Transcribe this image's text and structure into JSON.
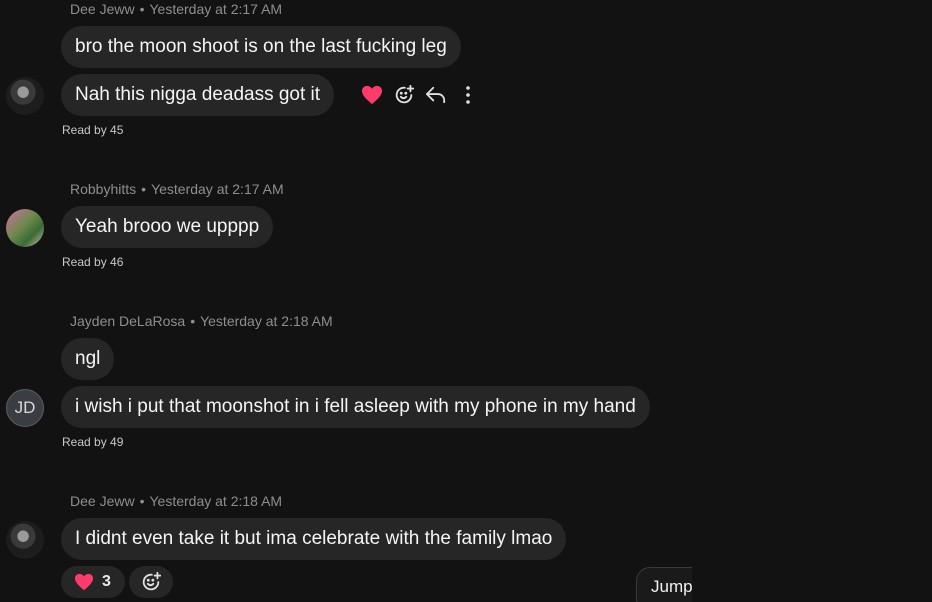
{
  "messages": [
    {
      "sender": "Dee Jeww",
      "time": "Yesterday at 2:17 AM",
      "bubbles": [
        "bro the moon shoot is on the last fucking leg",
        "Nah this nigga deadass got it"
      ],
      "read": "Read by 45"
    },
    {
      "sender": "Robbyhitts",
      "time": "Yesterday at 2:17 AM",
      "bubbles": [
        "Yeah brooo we upppp"
      ],
      "read": "Read by 46"
    },
    {
      "sender": "Jayden DeLaRosa",
      "time": "Yesterday at 2:18 AM",
      "avatar_initials": "JD",
      "bubbles": [
        "ngl",
        "i wish i put that moonshot in i fell asleep with my phone in my hand"
      ],
      "read": "Read by 49"
    },
    {
      "sender": "Dee Jeww",
      "time": "Yesterday at 2:18 AM",
      "bubbles": [
        "I didnt even take it but ima celebrate with the family lmao"
      ],
      "reaction": {
        "icon": "heart-icon",
        "count": "3"
      }
    }
  ],
  "separator": "•",
  "hover_actions": [
    "heart-icon",
    "add-reaction-icon",
    "reply-icon",
    "more-icon"
  ],
  "jump_button": {
    "label": "Jump"
  },
  "colors": {
    "background": "#121212",
    "bubble": "#262626",
    "meta_text": "#8e8e8e",
    "heart": "#ff3b6b"
  }
}
